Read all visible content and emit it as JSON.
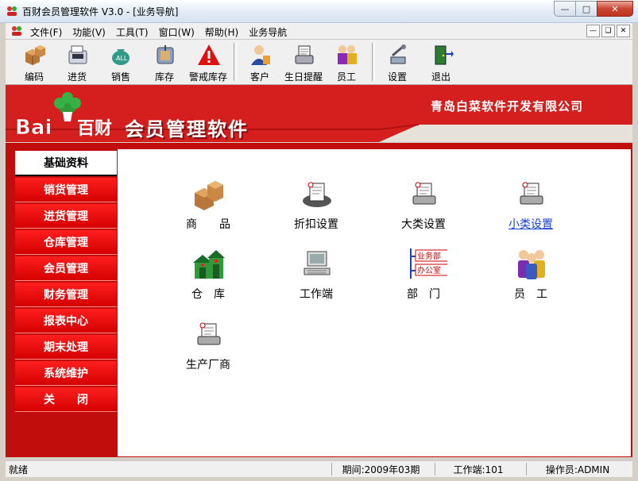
{
  "window": {
    "title": "百财会员管理软件 V3.0 - [业务导航]"
  },
  "menu": [
    "文件(F)",
    "功能(V)",
    "工具(T)",
    "窗口(W)",
    "帮助(H)",
    "业务导航"
  ],
  "toolbar": [
    "编码",
    "进货",
    "销售",
    "库存",
    "警戒库存",
    "客户",
    "生日提醒",
    "员工",
    "设置",
    "退出"
  ],
  "banner": {
    "logo_text": "Bai百财",
    "app_name": "会员管理软件",
    "company": "青岛白菜软件开发有限公司"
  },
  "sidebar": [
    "基础资料",
    "销货管理",
    "进货管理",
    "仓库管理",
    "会员管理",
    "财务管理",
    "报表中心",
    "期末处理",
    "系统维护",
    "关　　闭"
  ],
  "grid": [
    {
      "label": "商　　品",
      "icon": "boxes-icon"
    },
    {
      "label": "折扣设置",
      "icon": "printer-form-icon"
    },
    {
      "label": "大类设置",
      "icon": "printer-form-icon"
    },
    {
      "label": "小类设置",
      "icon": "printer-form-icon",
      "link": true
    },
    {
      "label": "仓　库",
      "icon": "warehouse-icon"
    },
    {
      "label": "工作端",
      "icon": "computer-icon"
    },
    {
      "label": "部　门",
      "icon": "org-chart-icon"
    },
    {
      "label": "员　工",
      "icon": "people-icon"
    },
    {
      "label": "生产厂商",
      "icon": "printer-form-icon"
    }
  ],
  "org_labels": [
    "业务部",
    "办公室"
  ],
  "status": {
    "ready": "就绪",
    "period": "期间:2009年03期",
    "workstation": "工作端:101",
    "operator": "操作员:ADMIN"
  }
}
